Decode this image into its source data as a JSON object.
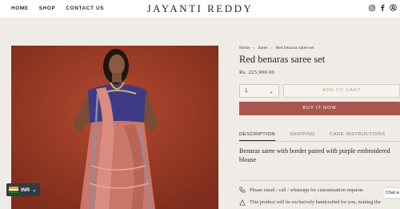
{
  "header": {
    "nav": [
      "HOME",
      "SHOP",
      "CONTACT US"
    ],
    "brand": "JAYANTI REDDY",
    "icons": [
      "instagram-icon",
      "facebook-icon",
      "account-icon"
    ]
  },
  "breadcrumb": {
    "items": [
      "Home",
      "Saree",
      "Red benaras saree set"
    ],
    "separator": "›"
  },
  "product": {
    "title": "Red benaras saree set",
    "price": "Rs. 225,900.00",
    "quantity": "1",
    "add_to_cart": "ADD TO CART",
    "buy_now": "BUY IT NOW",
    "tabs": [
      "DESCRIPTION",
      "SHIPPING",
      "CARE INSTRUCTIONS"
    ],
    "active_tab": "DESCRIPTION",
    "description": "Benaras saree with border paired with purple embroidered blouse",
    "enquiry": "Please email / call / whatsapp for customisation requests",
    "handcrafted_note": "This product will be exclusively handcrafted for you, making the"
  },
  "currency": {
    "code": "INR",
    "flag_colors": [
      "#ff9933",
      "#ffffff",
      "#138808"
    ]
  },
  "chat": {
    "label": "Chat w"
  },
  "colors": {
    "buy_now": "#a8574f",
    "background": "#efebe6",
    "photo_backdrop": "#9a3a25"
  }
}
